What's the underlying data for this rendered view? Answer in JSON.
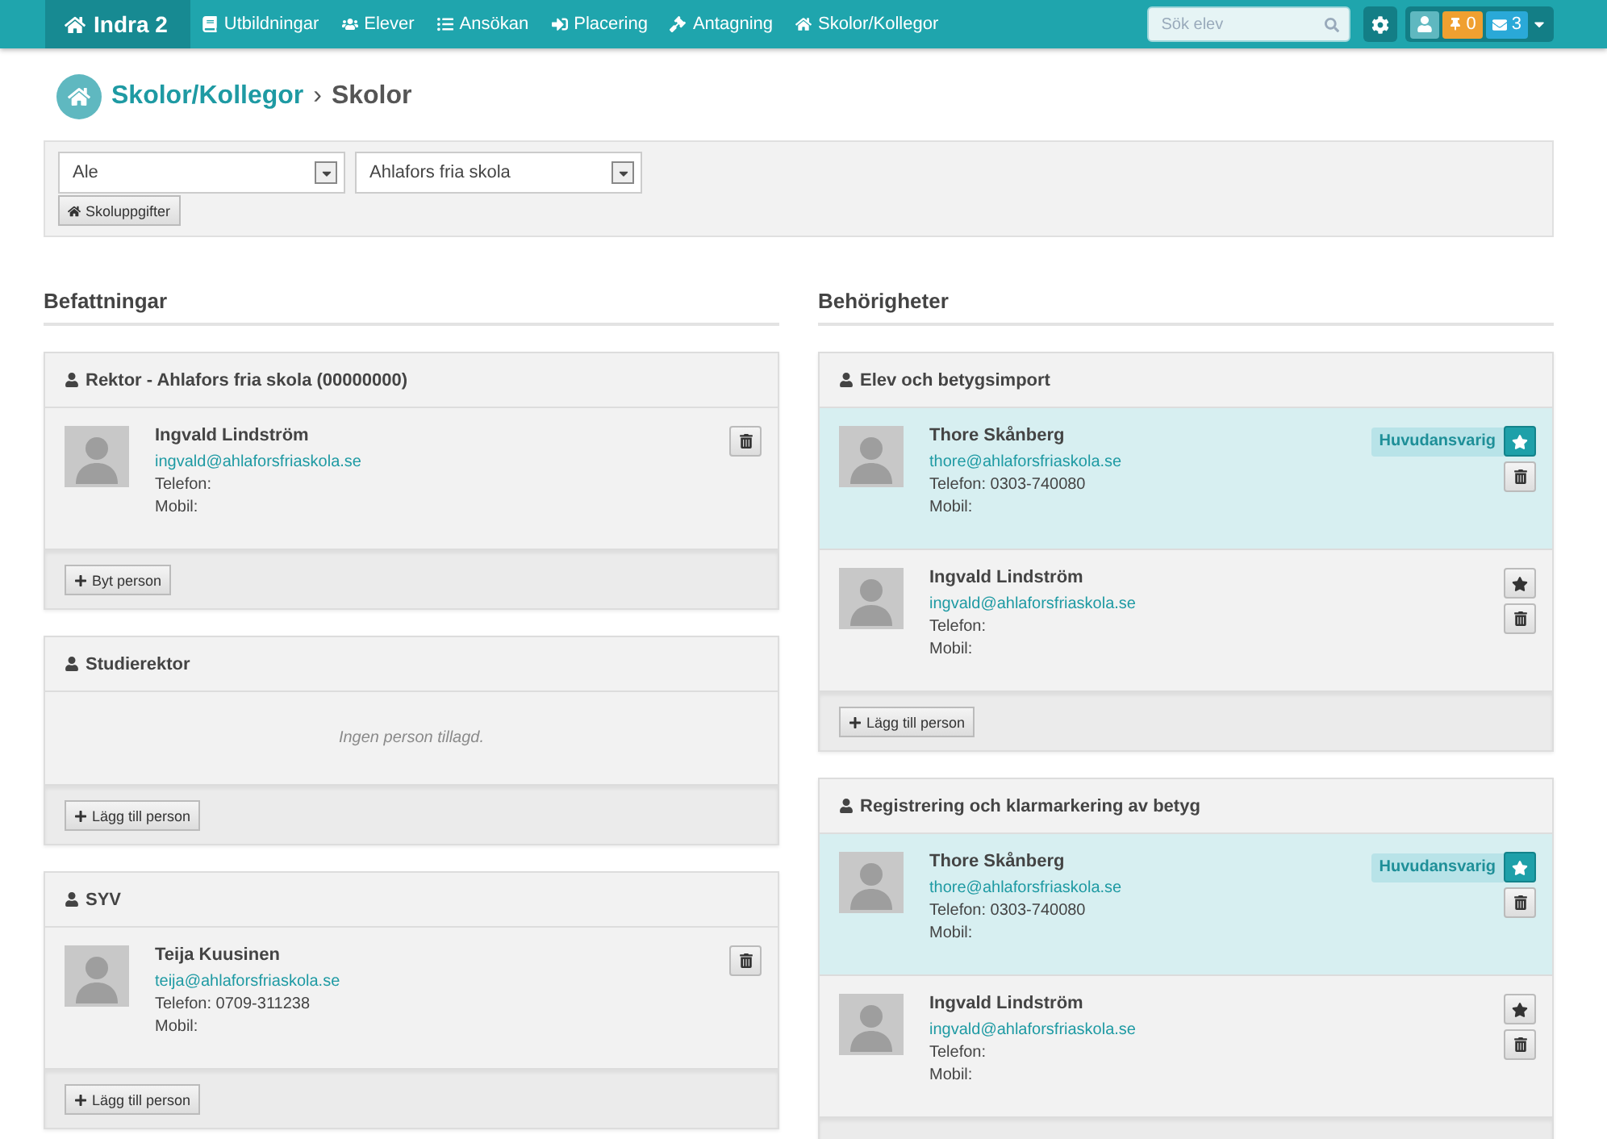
{
  "navbar": {
    "brand": "Indra 2",
    "items": [
      {
        "label": "Utbildningar"
      },
      {
        "label": "Elever"
      },
      {
        "label": "Ansökan"
      },
      {
        "label": "Placering"
      },
      {
        "label": "Antagning"
      },
      {
        "label": "Skolor/Kollegor"
      }
    ],
    "search": {
      "placeholder": "Sök elev"
    },
    "pin_count": "0",
    "mail_count": "3"
  },
  "breadcrumb": {
    "parent": "Skolor/Kollegor",
    "separator": "›",
    "current": "Skolor"
  },
  "filters": {
    "selects": [
      {
        "value": "Ale"
      },
      {
        "value": "Ahlafors fria skola"
      }
    ],
    "button": "Skoluppgifter"
  },
  "columns": [
    {
      "title": "Befattningar",
      "panels": [
        {
          "kind": "position",
          "title": "Rektor - Ahlafors fria skola (00000000)",
          "persons": [
            {
              "name": "Ingvald Lindström",
              "email": "ingvald@ahlaforsfriaskola.se",
              "phone": "Telefon:",
              "mobile": "Mobil:"
            }
          ],
          "footer_button": "Byt person"
        },
        {
          "kind": "position",
          "title": "Studierektor",
          "empty_text": "Ingen person tillagd.",
          "footer_button": "Lägg till person"
        },
        {
          "kind": "position",
          "title": "SYV",
          "persons": [
            {
              "name": "Teija Kuusinen",
              "email": "teija@ahlaforsfriaskola.se",
              "phone": "Telefon: 0709-311238",
              "mobile": "Mobil:"
            }
          ],
          "footer_button": "Lägg till person"
        }
      ]
    },
    {
      "title": "Behörigheter",
      "panels": [
        {
          "kind": "permission",
          "title": "Elev och betygsimport",
          "persons": [
            {
              "name": "Thore Skånberg",
              "email": "thore@ahlaforsfriaskola.se",
              "phone": "Telefon: 0303-740080",
              "mobile": "Mobil:",
              "primary": true,
              "badge": "Huvudansvarig"
            },
            {
              "name": "Ingvald Lindström",
              "email": "ingvald@ahlaforsfriaskola.se",
              "phone": "Telefon:",
              "mobile": "Mobil:",
              "primary": false
            }
          ],
          "footer_button": "Lägg till person"
        },
        {
          "kind": "permission",
          "title": "Registrering och klarmarkering av betyg",
          "persons": [
            {
              "name": "Thore Skånberg",
              "email": "thore@ahlaforsfriaskola.se",
              "phone": "Telefon: 0303-740080",
              "mobile": "Mobil:",
              "primary": true,
              "badge": "Huvudansvarig"
            },
            {
              "name": "Ingvald Lindström",
              "email": "ingvald@ahlaforsfriaskola.se",
              "phone": "Telefon:",
              "mobile": "Mobil:",
              "primary": false
            }
          ]
        }
      ]
    }
  ]
}
